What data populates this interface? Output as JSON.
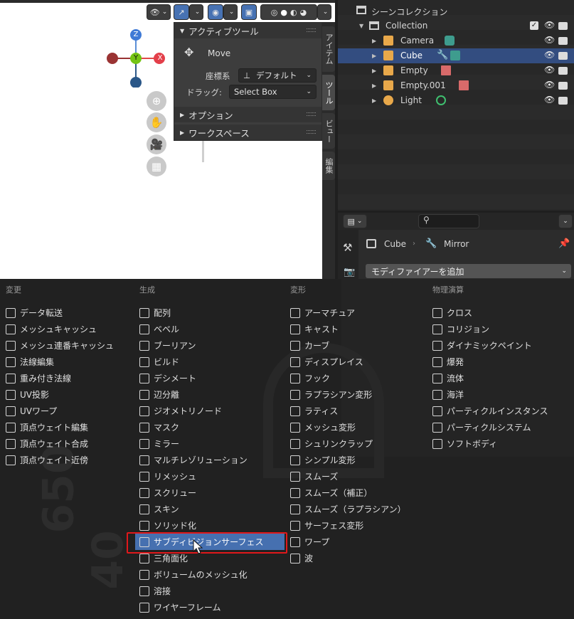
{
  "viewport": {
    "gizmo": {
      "z": "Z",
      "y": "Y",
      "x": "X"
    },
    "toolpanel": {
      "title": "アクティブツール",
      "tool": "Move",
      "coord_label": "座標系",
      "coord_value": "デフォルト",
      "drag_label": "ドラッグ:",
      "drag_value": "Select Box",
      "options": "オプション",
      "workspace": "ワークスペース"
    },
    "tabs": [
      "アイテム",
      "ツール",
      "ビュー",
      "編集"
    ]
  },
  "outliner": {
    "title": "シーンコレクション",
    "rows": [
      {
        "label": "Collection"
      },
      {
        "label": "Camera"
      },
      {
        "label": "Cube"
      },
      {
        "label": "Empty"
      },
      {
        "label": "Empty.001"
      },
      {
        "label": "Light"
      }
    ]
  },
  "properties": {
    "breadcrumb_object": "Cube",
    "breadcrumb_modifier": "Mirror",
    "add_modifier": "モディファイアーを追加"
  },
  "menu": {
    "columns": [
      {
        "title": "変更",
        "items": [
          "データ転送",
          "メッシュキャッシュ",
          "メッシュ連番キャッシュ",
          "法線編集",
          "重み付き法線",
          "UV投影",
          "UVワープ",
          "頂点ウェイト編集",
          "頂点ウェイト合成",
          "頂点ウェイト近傍"
        ]
      },
      {
        "title": "生成",
        "items": [
          "配列",
          "ベベル",
          "ブーリアン",
          "ビルド",
          "デシメート",
          "辺分離",
          "ジオメトリノード",
          "マスク",
          "ミラー",
          "マルチレゾリューション",
          "リメッシュ",
          "スクリュー",
          "スキン",
          "ソリッド化",
          "サブディビジョンサーフェス",
          "三角面化",
          "ボリュームのメッシュ化",
          "溶接",
          "ワイヤーフレーム"
        ]
      },
      {
        "title": "変形",
        "items": [
          "アーマチュア",
          "キャスト",
          "カーブ",
          "ディスプレイス",
          "フック",
          "ラプラシアン変形",
          "ラティス",
          "メッシュ変形",
          "シュリンクラップ",
          "シンプル変形",
          "スムーズ",
          "スムーズ（補正）",
          "スムーズ（ラプラシアン）",
          "サーフェス変形",
          "ワープ",
          "波"
        ]
      },
      {
        "title": "物理演算",
        "items": [
          "クロス",
          "コリジョン",
          "ダイナミックペイント",
          "爆発",
          "流体",
          "海洋",
          "パーティクルインスタンス",
          "パーティクルシステム",
          "ソフトボディ"
        ]
      }
    ],
    "highlighted": "サブディビジョンサーフェス"
  },
  "background": {
    "n1": "650",
    "n2": "40"
  }
}
